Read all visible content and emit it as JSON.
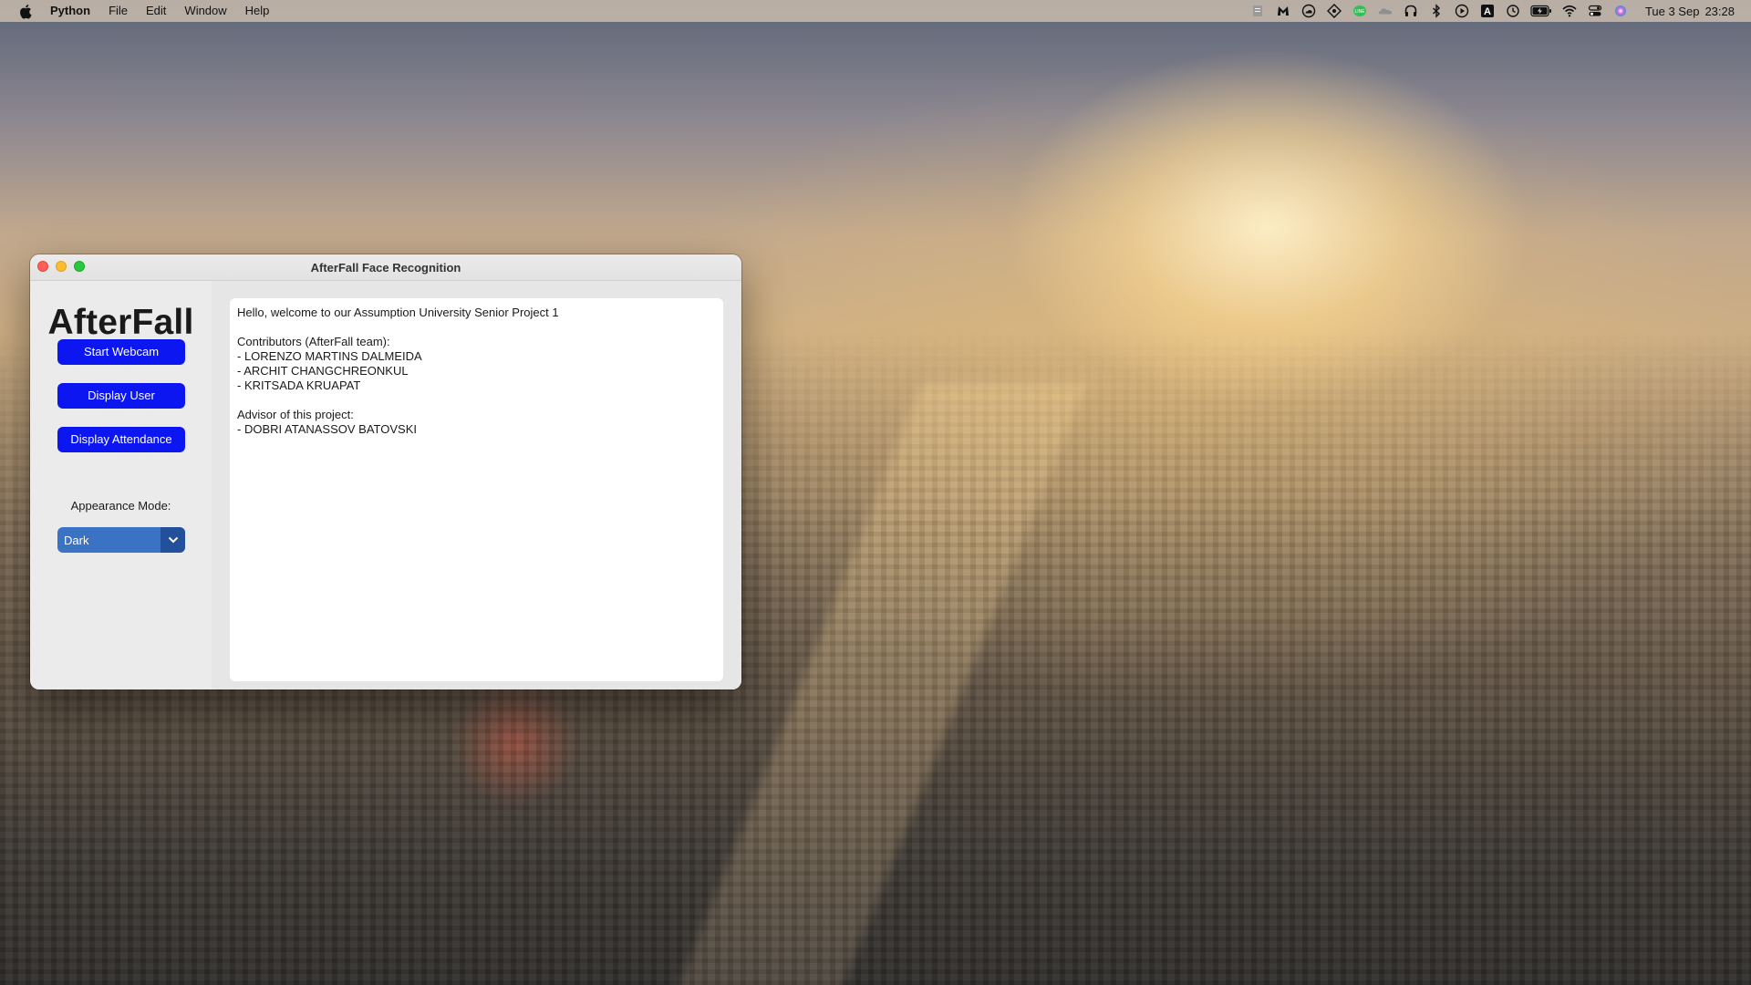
{
  "menubar": {
    "app_name": "Python",
    "items": [
      "File",
      "Edit",
      "Window",
      "Help"
    ],
    "status_icons": [
      "notes-icon",
      "malwarebytes-icon",
      "cloud-drive-icon",
      "vpn-icon",
      "line-icon",
      "cloud-icon",
      "headphones-icon",
      "bluetooth-icon",
      "play-icon",
      "keyboard-input-icon",
      "time-machine-icon",
      "battery-icon",
      "wifi-icon",
      "control-center-icon",
      "siri-icon"
    ],
    "input_source_label": "A",
    "date": "Tue 3 Sep",
    "time": "23:28"
  },
  "window": {
    "title": "AfterFall Face Recognition",
    "sidebar": {
      "logo": "AfterFall",
      "buttons": [
        "Start Webcam",
        "Display User",
        "Display Attendance"
      ],
      "appearance_label": "Appearance Mode:",
      "appearance_value": "Dark"
    },
    "textbox": {
      "lines": [
        "Hello, welcome to our Assumption University Senior Project 1",
        "",
        "Contributors (AfterFall team):",
        "- LORENZO MARTINS DALMEIDA",
        "- ARCHIT CHANGCHREONKUL",
        "- KRITSADA KRUAPAT",
        "",
        "Advisor of this project:",
        "- DOBRI ATANASSOV BATOVSKI"
      ]
    }
  },
  "colors": {
    "button_blue": "#0c16f0",
    "select_blue": "#3a72c4",
    "select_arrow_blue": "#23509b"
  }
}
